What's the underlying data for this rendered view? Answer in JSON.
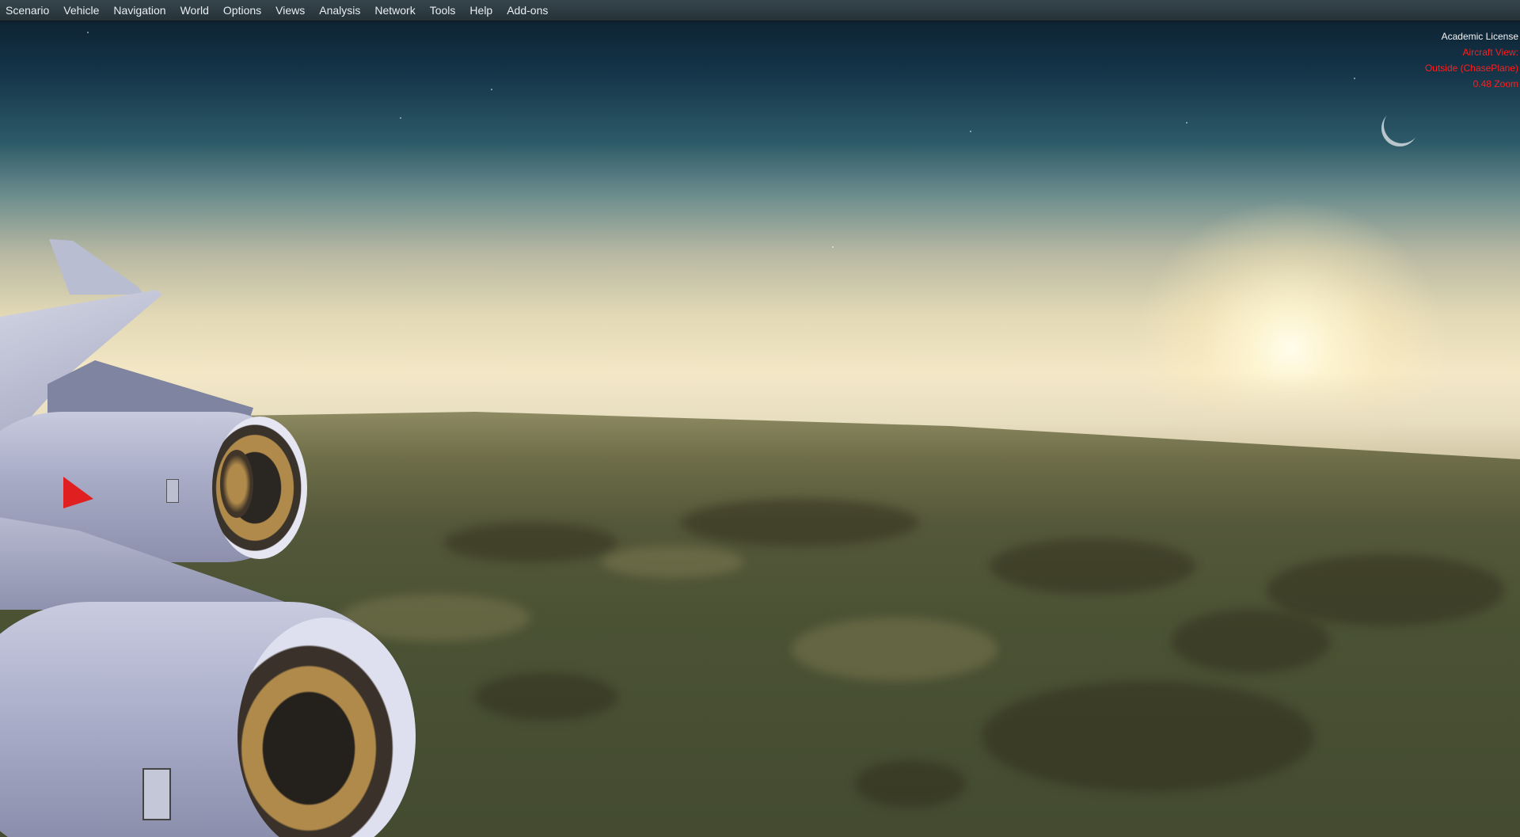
{
  "menubar": {
    "items": [
      {
        "label": "Scenario"
      },
      {
        "label": "Vehicle"
      },
      {
        "label": "Navigation"
      },
      {
        "label": "World"
      },
      {
        "label": "Options"
      },
      {
        "label": "Views"
      },
      {
        "label": "Analysis"
      },
      {
        "label": "Network"
      },
      {
        "label": "Tools"
      },
      {
        "label": "Help"
      },
      {
        "label": "Add-ons"
      }
    ]
  },
  "overlay": {
    "license": "Academic License",
    "aircraft_view": "Aircraft View:",
    "view_mode": "Outside (ChasePlane)",
    "zoom": "0.48 Zoom"
  },
  "colors": {
    "menubar_bg": "#2c3a41",
    "menu_text": "#e8eef2",
    "overlay_red": "#ff1e1e",
    "airline_tail_red": "#e02020"
  },
  "icons": {
    "engine_logo": "rolls-royce-badge-icon",
    "nacelle_logo": "kangaroo-logo-icon"
  }
}
